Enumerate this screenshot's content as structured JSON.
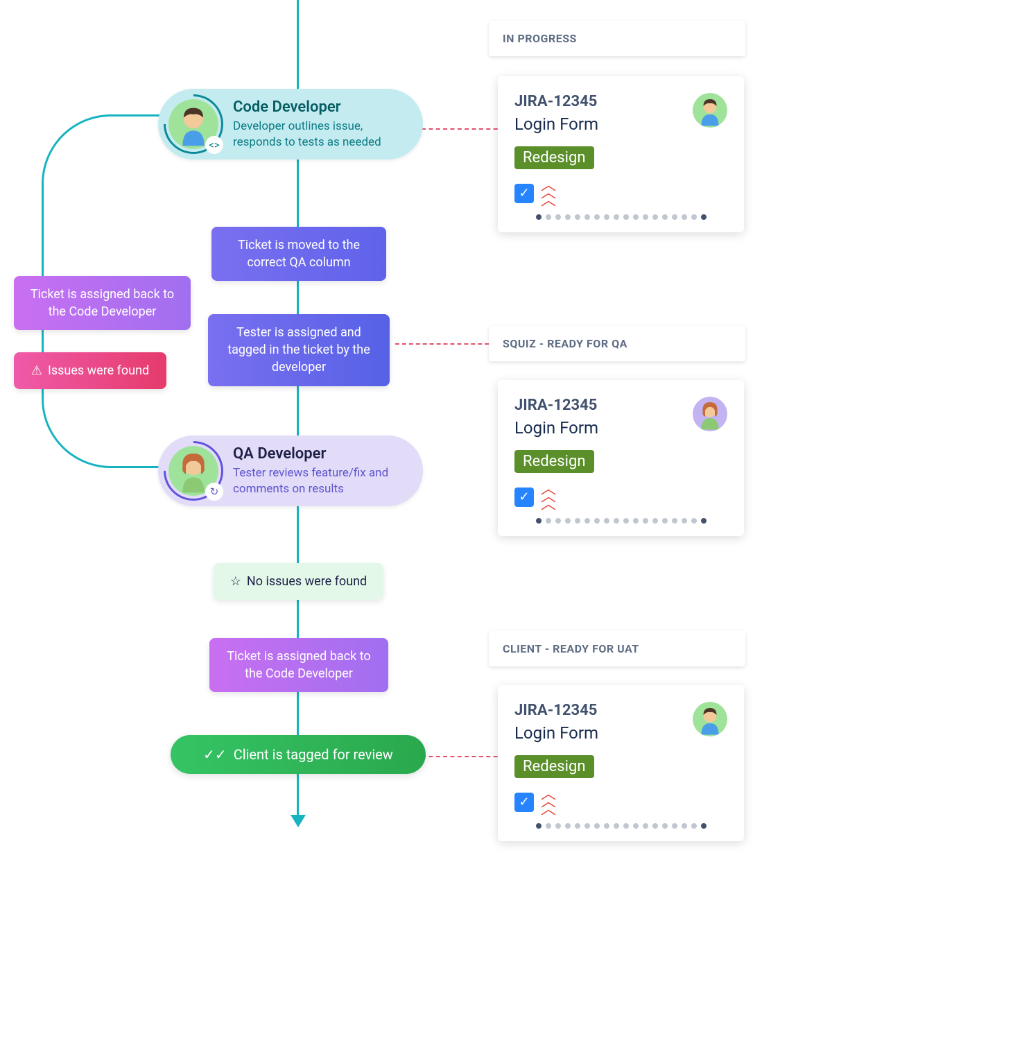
{
  "roles": {
    "developer": {
      "title": "Code Developer",
      "desc": "Developer outlines issue, responds to tests as needed"
    },
    "qa": {
      "title": "QA Developer",
      "desc": "Tester reviews feature/fix and comments on results"
    }
  },
  "steps": {
    "move_qa": "Ticket is moved to the correct QA column",
    "tester_assigned": "Tester is assigned and tagged in the ticket by the developer",
    "assigned_back_loop": "Ticket is assigned back to the Code Developer",
    "issues_found": "Issues were found",
    "no_issues": "No issues were found",
    "assigned_back_2": "Ticket is assigned back to the Code Developer",
    "client_tagged": "Client is tagged for review"
  },
  "columns": {
    "in_progress": "IN PROGRESS",
    "ready_qa": "SQUIZ - READY FOR QA",
    "ready_uat": "CLIENT - READY FOR UAT"
  },
  "card": {
    "id": "JIRA-12345",
    "title": "Login Form",
    "tag": "Redesign"
  }
}
